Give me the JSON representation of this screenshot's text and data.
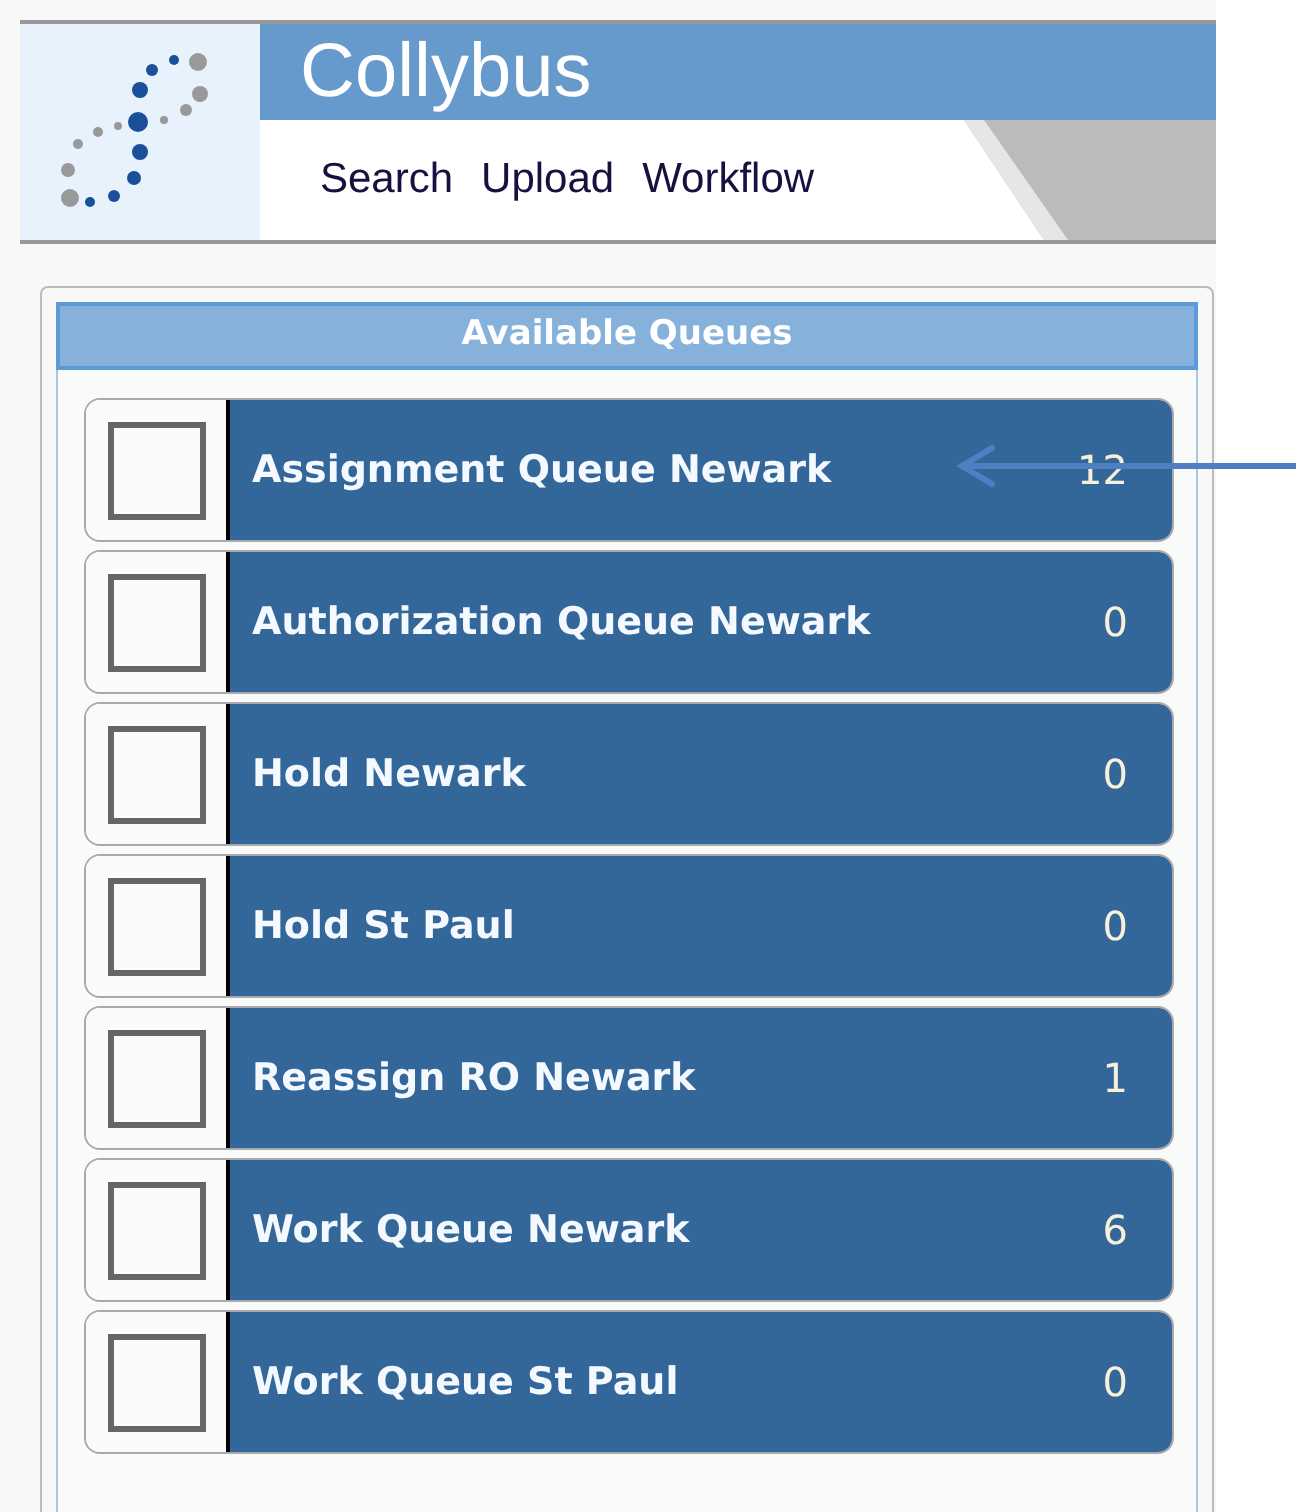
{
  "app": {
    "title": "Collybus",
    "nav": [
      {
        "label": "Search"
      },
      {
        "label": "Upload"
      },
      {
        "label": "Workflow"
      }
    ]
  },
  "panel": {
    "title": "Available Queues",
    "queues": [
      {
        "name": "Assignment Queue Newark",
        "count": "12",
        "checked": false
      },
      {
        "name": "Authorization Queue Newark",
        "count": "0",
        "checked": false
      },
      {
        "name": "Hold Newark",
        "count": "0",
        "checked": false
      },
      {
        "name": "Hold St Paul",
        "count": "0",
        "checked": false
      },
      {
        "name": "Reassign RO Newark",
        "count": "1",
        "checked": false
      },
      {
        "name": "Work Queue Newark",
        "count": "6",
        "checked": false
      },
      {
        "name": "Work Queue St Paul",
        "count": "0",
        "checked": false
      }
    ]
  }
}
